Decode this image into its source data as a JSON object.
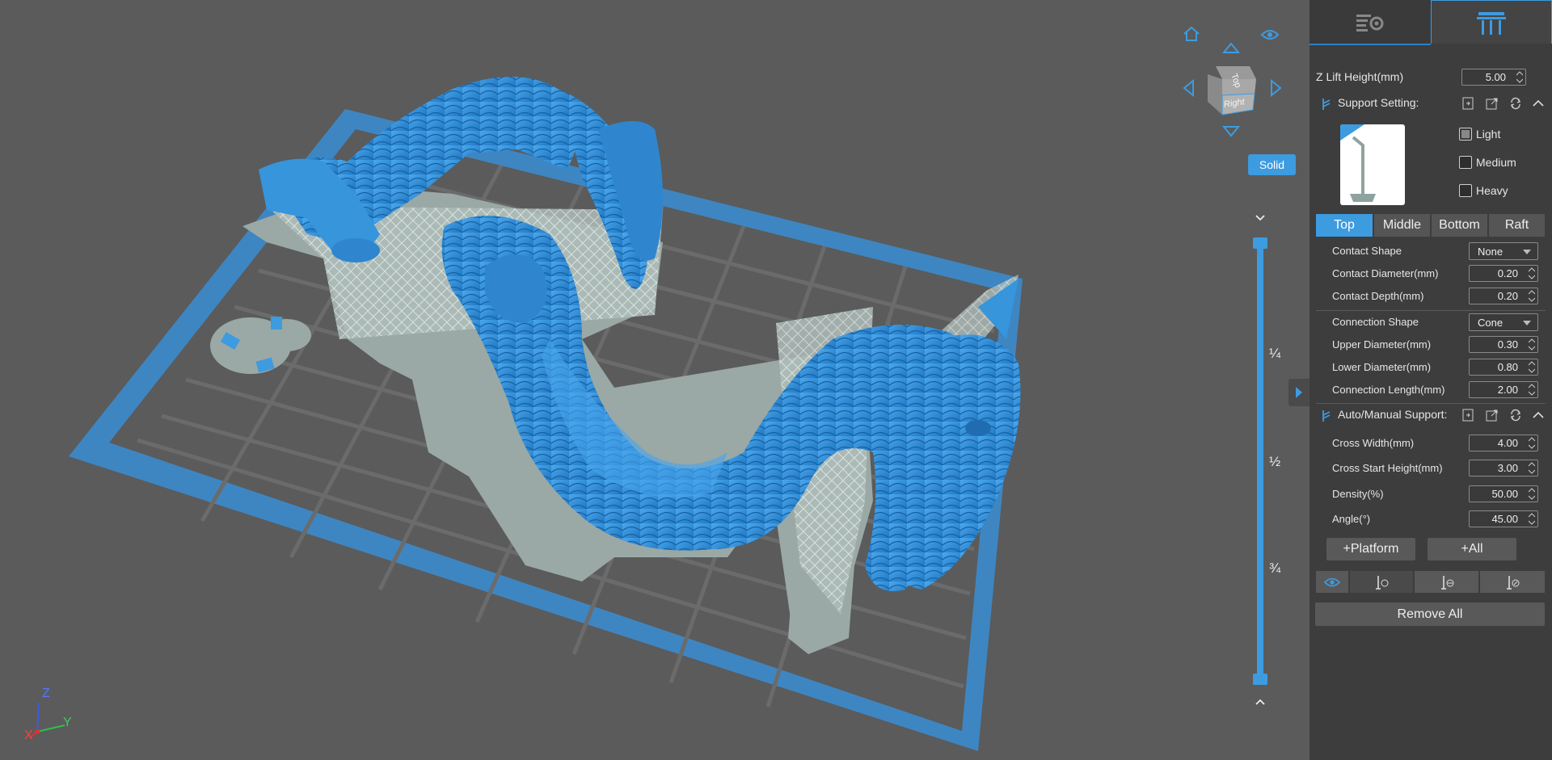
{
  "viewport": {
    "solid_label": "Solid",
    "view_cube": {
      "top": "Top",
      "right": "Right"
    },
    "slider": {
      "q1": "¼",
      "q2": "½",
      "q3": "¾"
    },
    "axis": {
      "x": "X",
      "y": "Y",
      "z": "Z"
    },
    "icons": [
      "home-icon",
      "eye-icon",
      "arrow-up-icon",
      "arrow-left-icon",
      "arrow-right-icon",
      "arrow-down-icon"
    ],
    "accent": "#3d9be0"
  },
  "panel": {
    "tabs": [
      "print-settings-tab",
      "support-tab"
    ],
    "z_lift": {
      "label": "Z Lift Height(mm)",
      "value": "5.00"
    },
    "support_setting": {
      "label": "Support Setting:",
      "presets": [
        {
          "label": "Light",
          "checked": true
        },
        {
          "label": "Medium",
          "checked": false
        },
        {
          "label": "Heavy",
          "checked": false
        }
      ],
      "segments": [
        "Top",
        "Middle",
        "Bottom",
        "Raft"
      ],
      "active_segment": "Top",
      "contact_shape": {
        "label": "Contact Shape",
        "value": "None"
      },
      "contact_diameter": {
        "label": "Contact Diameter(mm)",
        "value": "0.20"
      },
      "contact_depth": {
        "label": "Contact Depth(mm)",
        "value": "0.20"
      },
      "connection_shape": {
        "label": "Connection Shape",
        "value": "Cone"
      },
      "upper_diameter": {
        "label": "Upper Diameter(mm)",
        "value": "0.30"
      },
      "lower_diameter": {
        "label": "Lower Diameter(mm)",
        "value": "0.80"
      },
      "connection_length": {
        "label": "Connection Length(mm)",
        "value": "2.00"
      }
    },
    "auto_manual": {
      "label": "Auto/Manual Support:",
      "cross_width": {
        "label": "Cross Width(mm)",
        "value": "4.00"
      },
      "cross_start_height": {
        "label": "Cross Start Height(mm)",
        "value": "3.00"
      },
      "density": {
        "label": "Density(%)",
        "value": "50.00"
      },
      "angle": {
        "label": "Angle(°)",
        "value": "45.00"
      },
      "platform_button": "+Platform",
      "all_button": "+All"
    },
    "remove_all": "Remove All"
  }
}
